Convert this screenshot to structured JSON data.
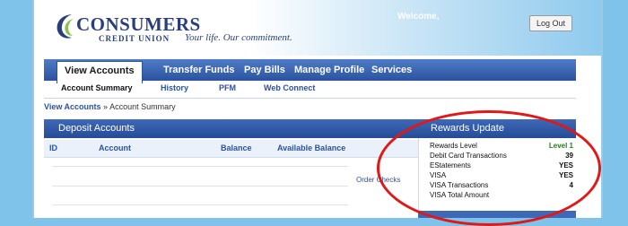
{
  "header": {
    "logo_name": "CONSUMERS",
    "logo_subtitle": "CREDIT UNION",
    "tagline": "Your life. Our commitment.",
    "welcome": "Welcome,",
    "logout_label": "Log Out"
  },
  "nav": {
    "tabs": [
      {
        "label": "View Accounts",
        "active": true
      },
      {
        "label": "Transfer Funds"
      },
      {
        "label": "Pay Bills"
      },
      {
        "label": "Manage Profile"
      },
      {
        "label": "Services"
      }
    ]
  },
  "subnav": {
    "items": [
      {
        "label": "Account Summary",
        "active": true
      },
      {
        "label": "History"
      },
      {
        "label": "PFM"
      },
      {
        "label": "Web Connect"
      }
    ]
  },
  "breadcrumb": {
    "link": "View Accounts",
    "separator": "»",
    "current": "Account Summary"
  },
  "deposit": {
    "title": "Deposit Accounts",
    "columns": [
      "ID",
      "Account",
      "Balance",
      "Available Balance"
    ],
    "order_checks": "Order Checks"
  },
  "rewards": {
    "title": "Rewards Update",
    "rows": [
      {
        "label": "Rewards Level",
        "value": "Level 1"
      },
      {
        "label": "Debit Card Transactions",
        "value": "39"
      },
      {
        "label": "EStatements",
        "value": "YES"
      },
      {
        "label": "VISA",
        "value": "YES"
      },
      {
        "label": "VISA Transactions",
        "value": "4"
      },
      {
        "label": "VISA Total Amount",
        "value": ""
      }
    ]
  },
  "colors": {
    "brand_navy": "#2a3f7a",
    "nav_blue": "#2b52a0",
    "page_background": "#7fc3ea",
    "highlight_circle": "#e01818",
    "level_green": "#2a7a1e"
  },
  "icons": {
    "logo": "cu-swoosh-logo-icon"
  }
}
